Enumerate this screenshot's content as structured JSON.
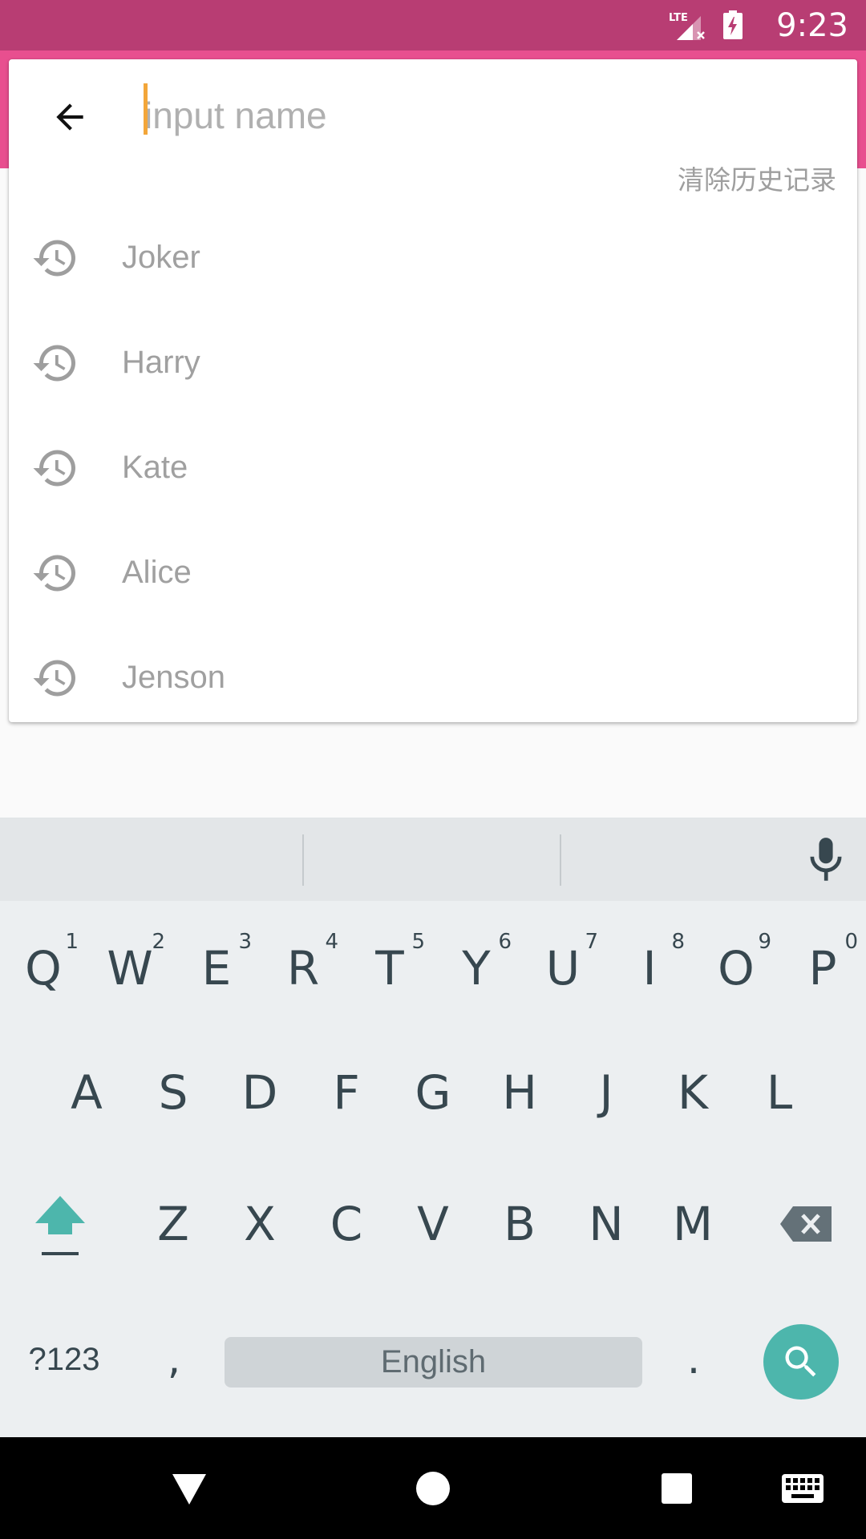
{
  "status_bar": {
    "time": "9:23",
    "network_label": "LTE"
  },
  "search": {
    "placeholder": "input name",
    "value": "",
    "clear_history_label": "清除历史记录"
  },
  "history": [
    {
      "label": "Joker",
      "icon": "history-icon"
    },
    {
      "label": "Harry",
      "icon": "history-icon"
    },
    {
      "label": "Kate",
      "icon": "history-icon"
    },
    {
      "label": "Alice",
      "icon": "history-icon"
    },
    {
      "label": "Jenson",
      "icon": "history-icon"
    }
  ],
  "keyboard": {
    "row1": [
      {
        "key": "Q",
        "hint": "1"
      },
      {
        "key": "W",
        "hint": "2"
      },
      {
        "key": "E",
        "hint": "3"
      },
      {
        "key": "R",
        "hint": "4"
      },
      {
        "key": "T",
        "hint": "5"
      },
      {
        "key": "Y",
        "hint": "6"
      },
      {
        "key": "U",
        "hint": "7"
      },
      {
        "key": "I",
        "hint": "8"
      },
      {
        "key": "O",
        "hint": "9"
      },
      {
        "key": "P",
        "hint": "0"
      }
    ],
    "row2": [
      "A",
      "S",
      "D",
      "F",
      "G",
      "H",
      "J",
      "K",
      "L"
    ],
    "row3": [
      "Z",
      "X",
      "C",
      "V",
      "B",
      "N",
      "M"
    ],
    "symbols_label": "?123",
    "comma_label": ",",
    "space_label": "English",
    "period_label": ".",
    "accent_color": "#4db6ac"
  },
  "colors": {
    "status_bar": "#b83d73",
    "app_bar": "#e84f8f",
    "caret": "#f3a63a"
  }
}
